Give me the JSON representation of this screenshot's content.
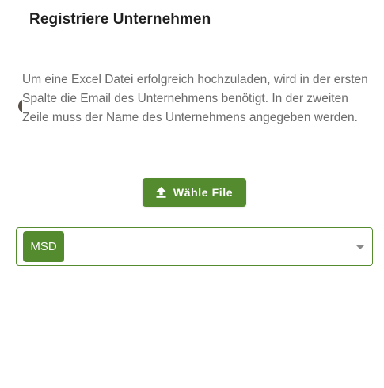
{
  "dialog": {
    "title": "Registriere Unternehmen",
    "description": "Um eine Excel Datei erfolgreich hochzuladen, wird in der ersten Spalte die Email des Unternehmens benötigt. In der zweiten Zeile muss der Name des Unternehmens angegeben werden."
  },
  "upload": {
    "label": "Wähle File",
    "icon": "upload-icon"
  },
  "company_select": {
    "selected_chip": "MSD",
    "arrow_icon": "dropdown-arrow-icon"
  },
  "colors": {
    "accent": "#558b2f",
    "title_text": "#202020",
    "body_text": "#6b6b6b"
  }
}
